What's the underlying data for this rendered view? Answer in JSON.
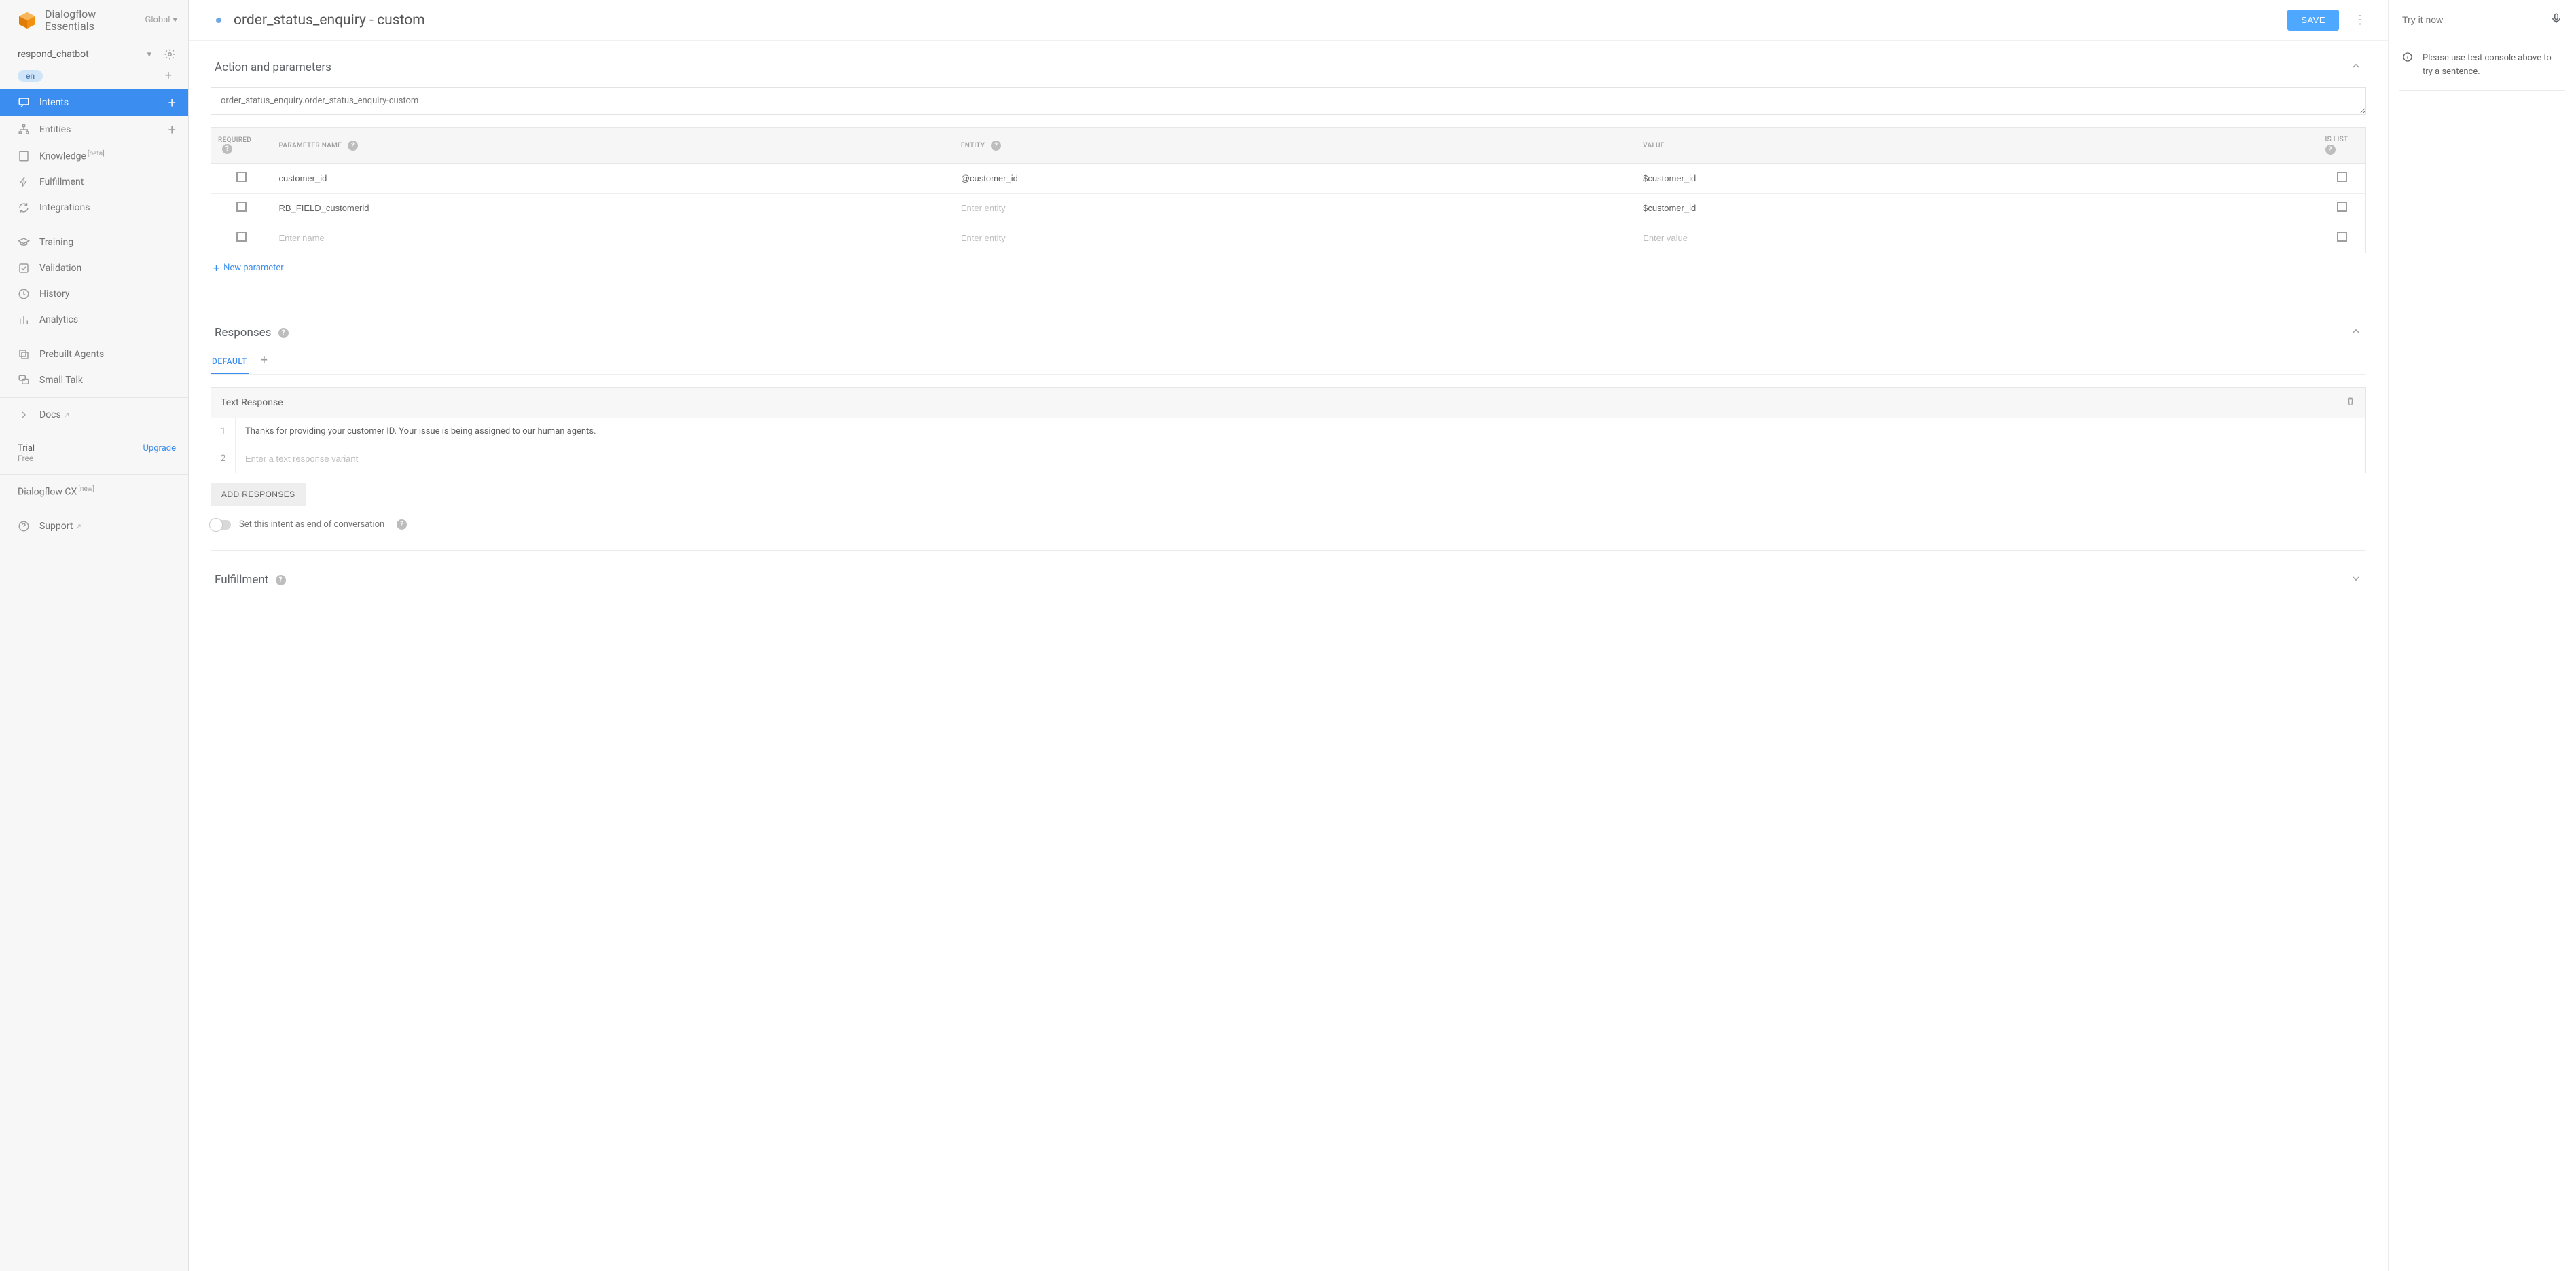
{
  "brand": {
    "line1": "Dialogflow",
    "line2": "Essentials",
    "region": "Global"
  },
  "agent": {
    "name": "respond_chatbot",
    "lang": "en"
  },
  "nav": {
    "intents": "Intents",
    "entities": "Entities",
    "knowledge": "Knowledge",
    "knowledge_badge": "[beta]",
    "fulfillment": "Fulfillment",
    "integrations": "Integrations",
    "training": "Training",
    "validation": "Validation",
    "history": "History",
    "analytics": "Analytics",
    "prebuilt": "Prebuilt Agents",
    "smalltalk": "Small Talk",
    "docs": "Docs",
    "trial_title": "Trial",
    "trial_plan": "Free",
    "upgrade": "Upgrade",
    "cx": "Dialogflow CX",
    "cx_badge": "[new]",
    "support": "Support"
  },
  "header": {
    "title": "order_status_enquiry - custom",
    "save": "SAVE"
  },
  "action_section": {
    "title": "Action and parameters",
    "action_value": "order_status_enquiry.order_status_enquiry-custom",
    "columns": {
      "required": "REQUIRED",
      "param": "PARAMETER NAME",
      "entity": "ENTITY",
      "value": "VALUE",
      "islist": "IS LIST"
    },
    "rows": [
      {
        "name": "customer_id",
        "entity": "@customer_id",
        "value": "$customer_id"
      },
      {
        "name": "RB_FIELD_customerid",
        "entity": "",
        "value": "$customer_id"
      },
      {
        "name": "",
        "entity": "",
        "value": ""
      }
    ],
    "placeholders": {
      "name": "Enter name",
      "entity": "Enter entity",
      "value": "Enter value"
    },
    "new_param": "New parameter"
  },
  "responses_section": {
    "title": "Responses",
    "default_tab": "DEFAULT",
    "text_response_title": "Text Response",
    "rows": [
      {
        "num": "1",
        "text": "Thanks for providing your customer ID. Your issue is being assigned to our human agents."
      },
      {
        "num": "2",
        "text": ""
      }
    ],
    "variant_placeholder": "Enter a text response variant",
    "add_responses": "ADD RESPONSES",
    "eoc_label": "Set this intent as end of conversation"
  },
  "fulfillment_section": {
    "title": "Fulfillment"
  },
  "try_panel": {
    "placeholder": "Try it now",
    "message": "Please use test console above to try a sentence."
  }
}
